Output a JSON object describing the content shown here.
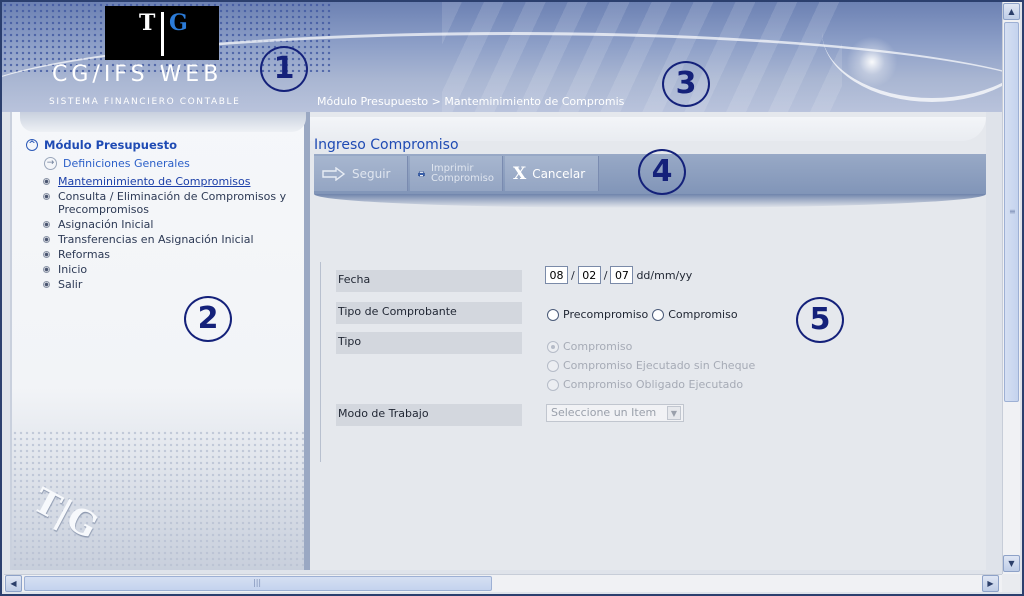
{
  "header": {
    "logo_t": "T",
    "logo_g": "G",
    "app_name": "CG/IFS  WEB",
    "app_subtitle": "SISTEMA FINANCIERO CONTABLE",
    "breadcrumb": "Módulo Presupuesto > Manteminimiento de Compromis"
  },
  "annotations": [
    "1",
    "2",
    "3",
    "4",
    "5"
  ],
  "sidebar": {
    "module_title": "Módulo Presupuesto",
    "definitions_link": "Definiciones Generales",
    "items": [
      {
        "label": "Manteminimiento de Compromisos",
        "active": true
      },
      {
        "label": "Consulta / Eliminación de Compromisos y Precompromisos",
        "active": false
      },
      {
        "label": "Asignación Inicial",
        "active": false
      },
      {
        "label": "Transferencias en Asignación Inicial",
        "active": false
      },
      {
        "label": "Reformas",
        "active": false
      },
      {
        "label": "Inicio",
        "active": false
      },
      {
        "label": "Salir",
        "active": false
      }
    ],
    "bottom_logo": "T|G"
  },
  "main": {
    "title": "Ingreso Compromiso",
    "toolbar": {
      "seguir": "Seguir",
      "imprimir_line1": "Imprimir",
      "imprimir_line2": "Compromiso",
      "cancelar": "Cancelar"
    },
    "form": {
      "fecha_label": "Fecha",
      "fecha_day": "08",
      "fecha_month": "02",
      "fecha_year": "07",
      "fecha_format": "dd/mm/yy",
      "tipo_comprobante_label": "Tipo de Comprobante",
      "tipo_comprobante_options": [
        "Precompromiso",
        "Compromiso"
      ],
      "tipo_label": "Tipo",
      "tipo_options": [
        "Compromiso",
        "Compromiso Ejecutado sin Cheque",
        "Compromiso Obligado Ejecutado"
      ],
      "modo_label": "Modo de Trabajo",
      "modo_value": "Seleccione un Item"
    }
  },
  "colors": {
    "accent_blue": "#1f4bb4",
    "annotation": "#14217a",
    "toolbar": "#8fa1c2"
  }
}
